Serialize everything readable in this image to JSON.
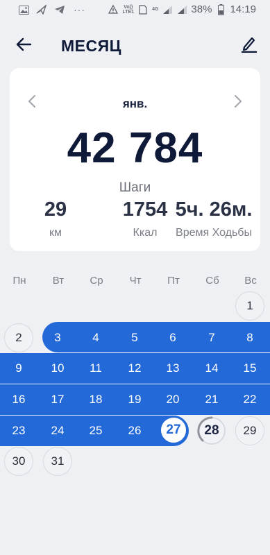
{
  "status_bar": {
    "left_icons": [
      "image-icon",
      "bird-icon",
      "telegram-icon"
    ],
    "dots": "···",
    "volte_label": "Vo))\nLTE1",
    "network_label": "4G",
    "battery": "38%",
    "time": "14:19"
  },
  "header": {
    "title": "МЕСЯЦ"
  },
  "summary": {
    "month": "янв.",
    "steps": "42 784",
    "steps_label": "Шаги",
    "stats": [
      {
        "value": "29",
        "label": "км"
      },
      {
        "value": "1754",
        "label": "Ккал"
      },
      {
        "value": "5ч. 26м.",
        "label": "Время Ходьбы"
      }
    ]
  },
  "calendar": {
    "weekdays": [
      "Пн",
      "Вт",
      "Ср",
      "Чт",
      "Пт",
      "Сб",
      "Вс"
    ],
    "days": [
      "1",
      "2",
      "3",
      "4",
      "5",
      "6",
      "7",
      "8",
      "9",
      "10",
      "11",
      "12",
      "13",
      "14",
      "15",
      "16",
      "17",
      "18",
      "19",
      "20",
      "21",
      "22",
      "23",
      "24",
      "25",
      "26",
      "27",
      "28",
      "29",
      "30",
      "31"
    ],
    "accent": "#2369d8",
    "today": "27",
    "in_progress_day": "28",
    "goal_reached_days": [
      "3",
      "4",
      "5",
      "6",
      "7",
      "8",
      "9",
      "10",
      "11",
      "12",
      "13",
      "14",
      "15",
      "16",
      "17",
      "18",
      "19",
      "20",
      "21",
      "22",
      "23",
      "24",
      "25",
      "26"
    ]
  }
}
